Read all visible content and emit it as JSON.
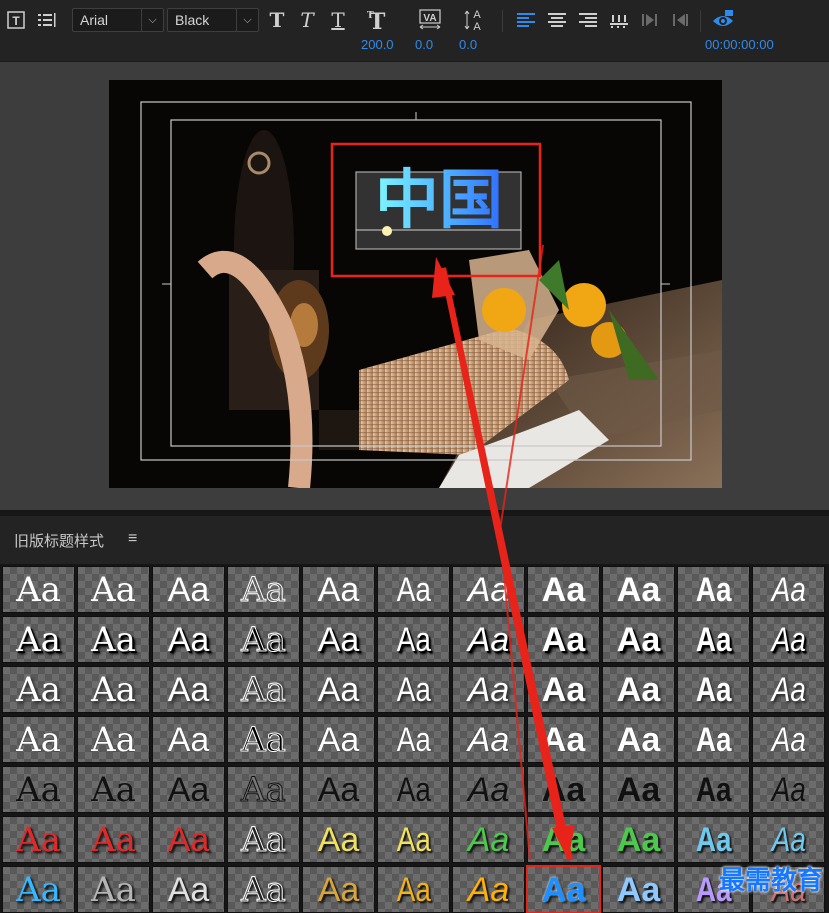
{
  "toolbar": {
    "title_tool_icon": "title-type-tool-icon",
    "align_menu_icon": "align-list-icon",
    "font_family": "Arial",
    "font_style": "Black",
    "font_size": "200.0",
    "kerning": "0.0",
    "leading": "0.0",
    "timecode": "00:00:00:00",
    "style_buttons": [
      "bold",
      "italic",
      "underline"
    ],
    "align_buttons": [
      "align-left",
      "align-center",
      "align-right"
    ]
  },
  "viewer": {
    "title_text": "中国",
    "highlight_color": "#e8231a"
  },
  "styles_panel": {
    "title": "旧版标题样式",
    "menu_icon": "≡",
    "sample_text": "Aa"
  },
  "watermark": "最需教育"
}
